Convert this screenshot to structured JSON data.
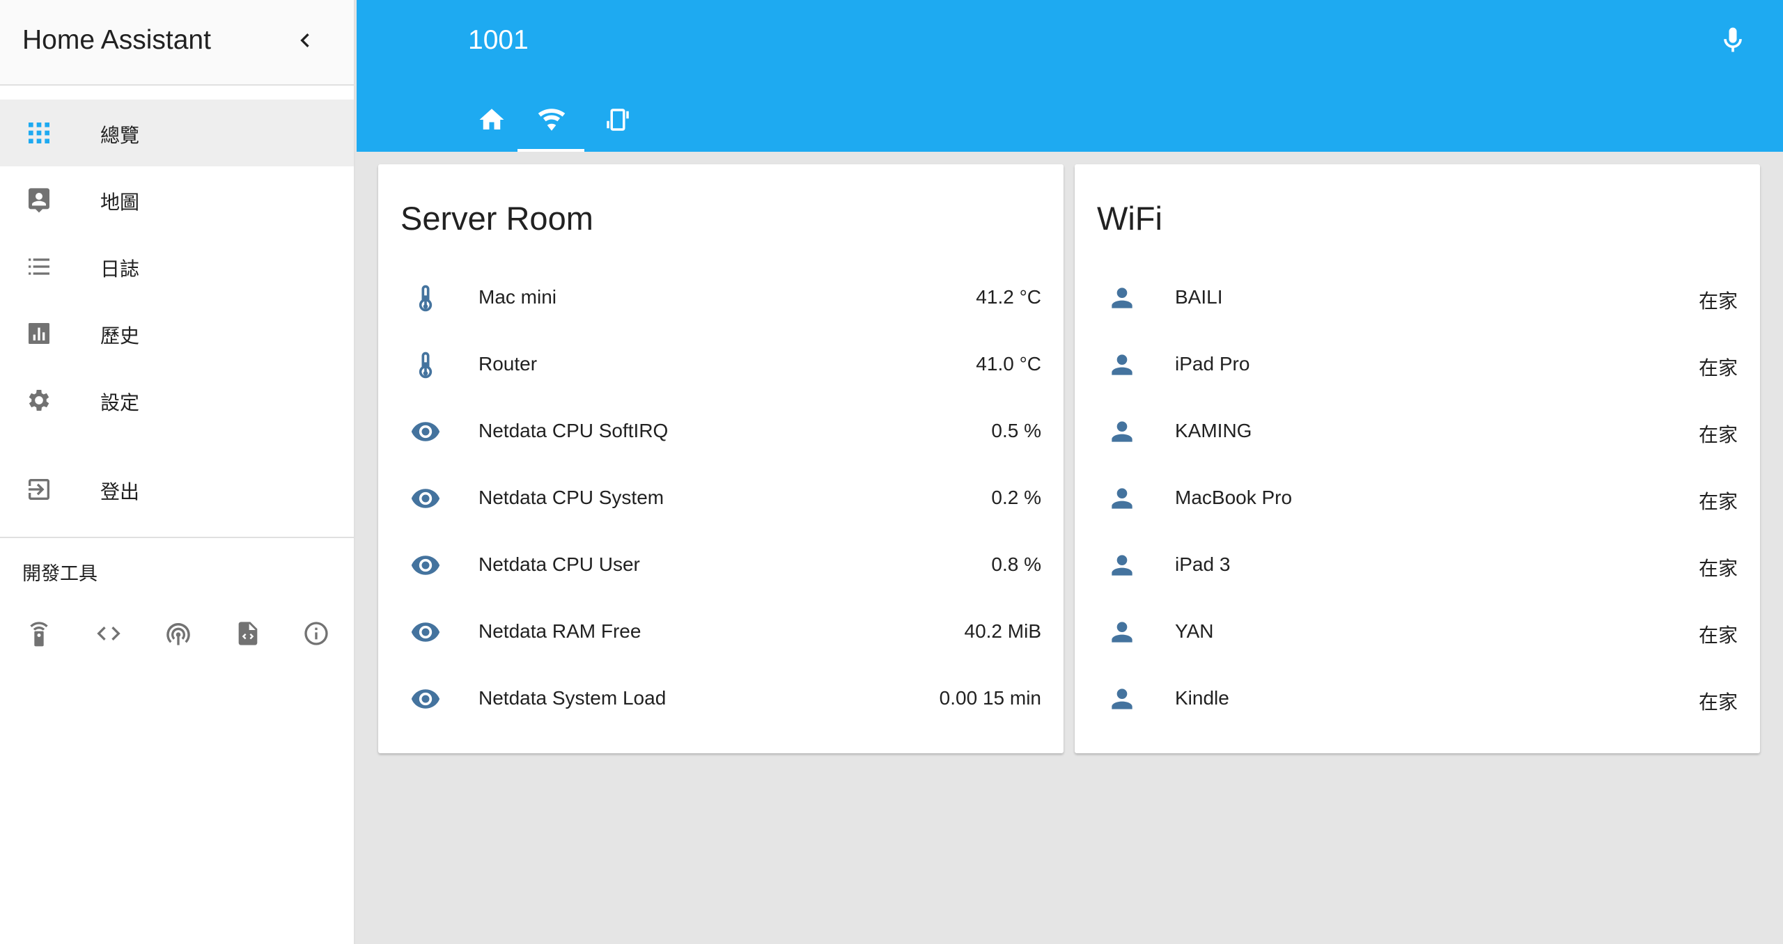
{
  "sidebar": {
    "title": "Home Assistant",
    "items": [
      {
        "label": "總覽",
        "icon": "apps-grid-icon",
        "active": true
      },
      {
        "label": "地圖",
        "icon": "account-location-icon"
      },
      {
        "label": "日誌",
        "icon": "list-icon"
      },
      {
        "label": "歷史",
        "icon": "chart-bar-icon"
      },
      {
        "label": "設定",
        "icon": "gear-icon"
      },
      {
        "label": "登出",
        "icon": "logout-icon"
      }
    ],
    "dev_tools_label": "開發工具",
    "dev_tools": [
      "remote-icon",
      "code-icon",
      "broadcast-icon",
      "file-code-icon",
      "info-icon"
    ]
  },
  "header": {
    "title": "1001",
    "tabs": [
      "home-icon",
      "wifi-icon",
      "phone-rotate-icon"
    ],
    "active_tab": 1,
    "accent_color": "#1eaaf1"
  },
  "cards": [
    {
      "title": "Server Room",
      "rows": [
        {
          "name": "Mac mini",
          "value": "41.2 °C",
          "icon": "thermometer-icon"
        },
        {
          "name": "Router",
          "value": "41.0 °C",
          "icon": "thermometer-icon"
        },
        {
          "name": "Netdata CPU SoftIRQ",
          "value": "0.5 %",
          "icon": "eye-icon"
        },
        {
          "name": "Netdata CPU System",
          "value": "0.2 %",
          "icon": "eye-icon"
        },
        {
          "name": "Netdata CPU User",
          "value": "0.8 %",
          "icon": "eye-icon"
        },
        {
          "name": "Netdata RAM Free",
          "value": "40.2 MiB",
          "icon": "eye-icon"
        },
        {
          "name": "Netdata System Load",
          "value": "0.00 15 min",
          "icon": "eye-icon"
        }
      ]
    },
    {
      "title": "WiFi",
      "rows": [
        {
          "name": "BAILI",
          "value": "在家",
          "icon": "account-icon"
        },
        {
          "name": "iPad Pro",
          "value": "在家",
          "icon": "account-icon"
        },
        {
          "name": "KAMING",
          "value": "在家",
          "icon": "account-icon"
        },
        {
          "name": "MacBook Pro",
          "value": "在家",
          "icon": "account-icon"
        },
        {
          "name": "iPad 3",
          "value": "在家",
          "icon": "account-icon"
        },
        {
          "name": "YAN",
          "value": "在家",
          "icon": "account-icon"
        },
        {
          "name": "Kindle",
          "value": "在家",
          "icon": "account-icon"
        }
      ]
    }
  ]
}
